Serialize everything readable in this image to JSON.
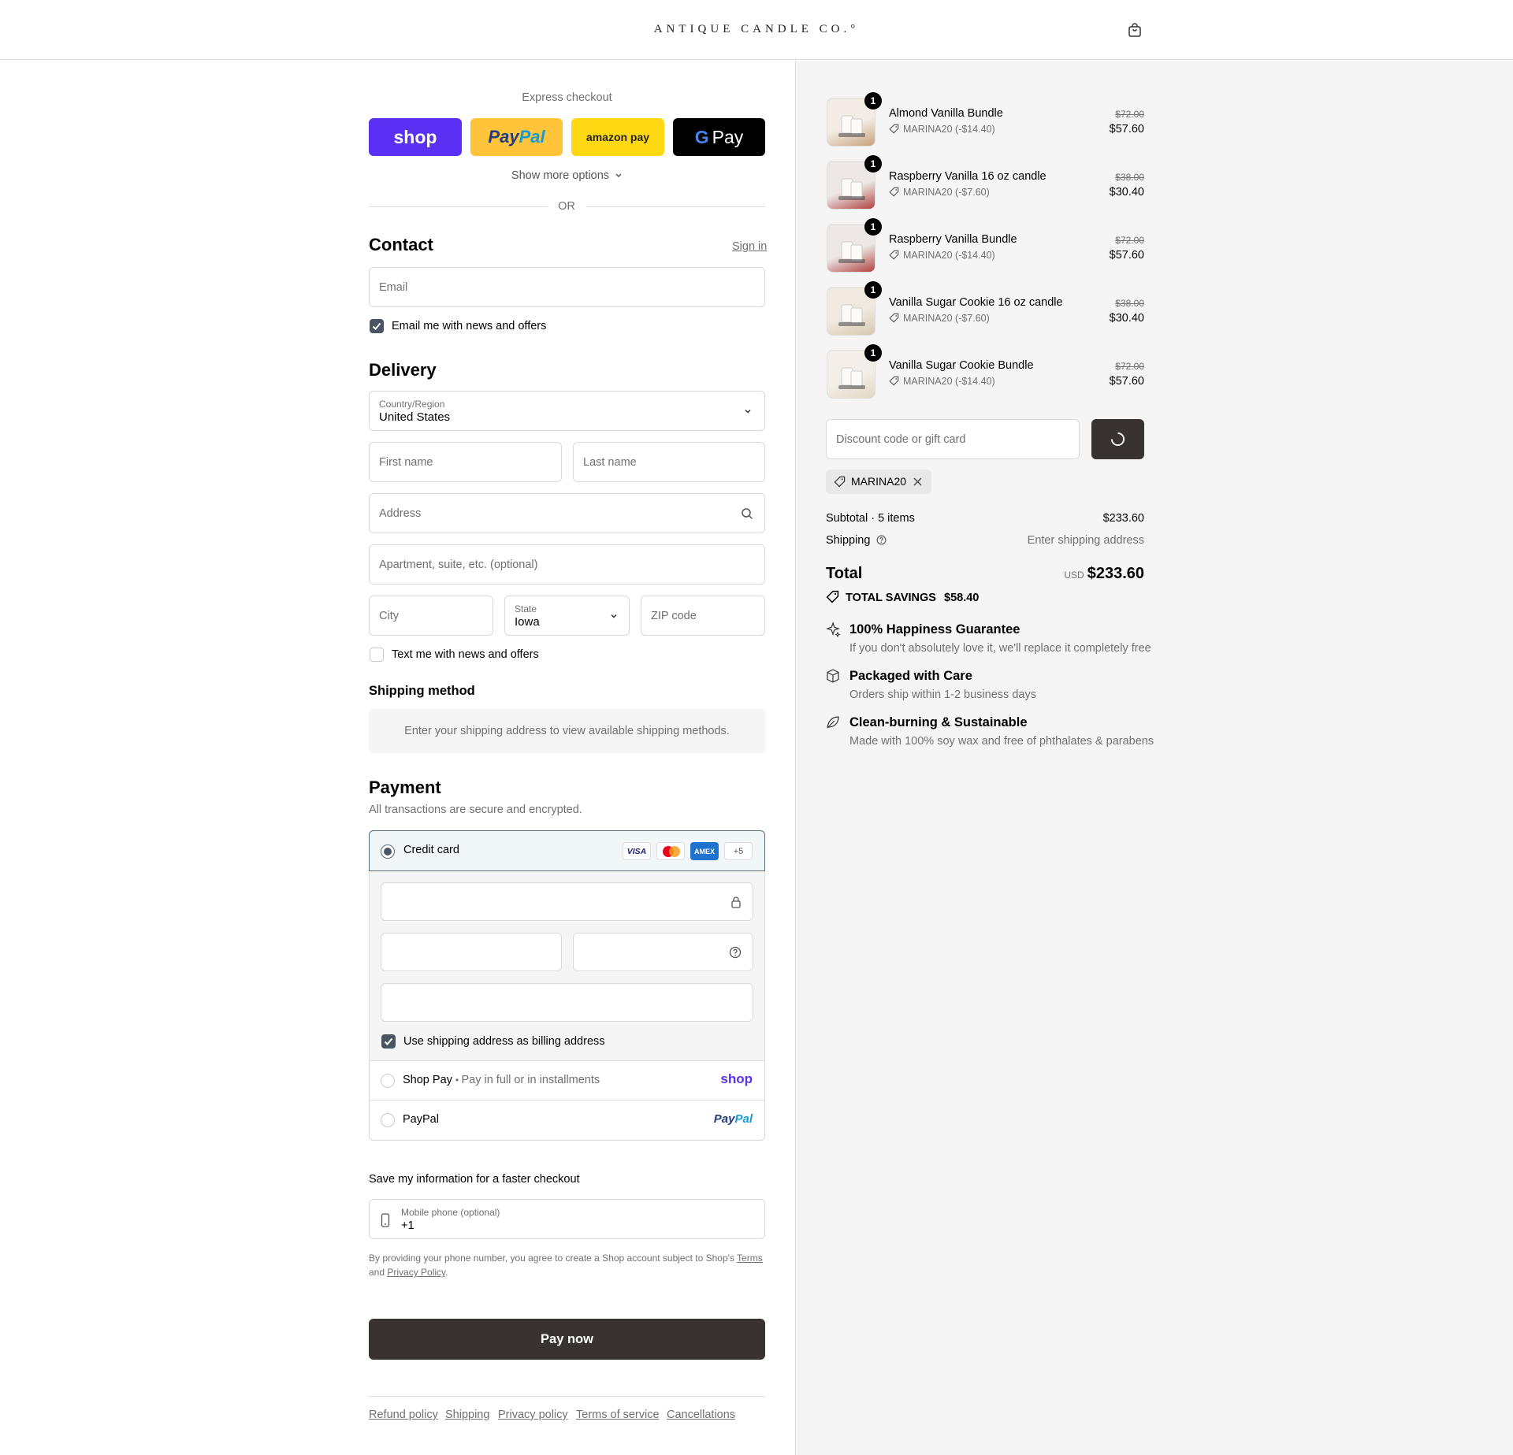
{
  "header": {
    "logo": "ANTIQUE CANDLE CO.°",
    "cart_icon": "cart-icon"
  },
  "express": {
    "title": "Express checkout",
    "buttons": {
      "shop": "shop",
      "paypal_a": "Pay",
      "paypal_b": "Pal",
      "amazon": "amazon pay",
      "gpay": "Pay"
    },
    "more": "Show more options",
    "or": "OR"
  },
  "contact": {
    "title": "Contact",
    "sign_in": "Sign in",
    "email_placeholder": "Email",
    "news_label": "Email me with news and offers"
  },
  "delivery": {
    "title": "Delivery",
    "country_label": "Country/Region",
    "country_value": "United States",
    "first_name": "First name",
    "last_name": "Last name",
    "address": "Address",
    "apartment": "Apartment, suite, etc. (optional)",
    "city": "City",
    "state_label": "State",
    "state_value": "Iowa",
    "zip": "ZIP code",
    "text_label": "Text me with news and offers"
  },
  "shipping_method": {
    "title": "Shipping method",
    "notice": "Enter your shipping address to view available shipping methods."
  },
  "payment": {
    "title": "Payment",
    "subtitle": "All transactions are secure and encrypted.",
    "credit_card": "Credit card",
    "brands": {
      "visa": "VISA",
      "amex": "AMEX",
      "more": "+5"
    },
    "billing_label": "Use shipping address as billing address",
    "shop_pay": "Shop Pay",
    "shop_pay_sub": "Pay in full or in installments",
    "shop_pay_logo": "shop",
    "paypal": "PayPal",
    "paypal_logo_a": "Pay",
    "paypal_logo_b": "Pal"
  },
  "save": {
    "title": "Save my information for a faster checkout",
    "phone_label": "Mobile phone (optional)",
    "phone_value": "+1",
    "consent_a": "By providing your phone number, you agree to create a Shop account subject to Shop's",
    "terms": "Terms",
    "consent_b": "and",
    "privacy": "Privacy Policy",
    "consent_c": "."
  },
  "pay_now": "Pay now",
  "footer": [
    "Refund policy",
    "Shipping",
    "Privacy policy",
    "Terms of service",
    "Cancellations"
  ],
  "items": [
    {
      "qty": "1",
      "name": "Almond Vanilla Bundle",
      "discount": "MARINA20 (-$14.40)",
      "old": "$72.00",
      "price": "$57.60"
    },
    {
      "qty": "1",
      "name": "Raspberry Vanilla 16 oz candle",
      "discount": "MARINA20 (-$7.60)",
      "old": "$38.00",
      "price": "$30.40"
    },
    {
      "qty": "1",
      "name": "Raspberry Vanilla Bundle",
      "discount": "MARINA20 (-$14.40)",
      "old": "$72.00",
      "price": "$57.60"
    },
    {
      "qty": "1",
      "name": "Vanilla Sugar Cookie 16 oz candle",
      "discount": "MARINA20 (-$7.60)",
      "old": "$38.00",
      "price": "$30.40"
    },
    {
      "qty": "1",
      "name": "Vanilla Sugar Cookie Bundle",
      "discount": "MARINA20 (-$14.40)",
      "old": "$72.00",
      "price": "$57.60"
    }
  ],
  "summary": {
    "discount_placeholder": "Discount code or gift card",
    "code_tag": "MARINA20",
    "subtotal_label": "Subtotal · 5 items",
    "subtotal_value": "$233.60",
    "shipping_label": "Shipping",
    "shipping_value": "Enter shipping address",
    "total_label": "Total",
    "currency": "USD",
    "total_value": "$233.60",
    "savings_label": "TOTAL SAVINGS",
    "savings_value": "$58.40"
  },
  "perks": [
    {
      "icon": "sparkle-icon",
      "title": "100% Happiness Guarantee",
      "text": "If you don't absolutely love it, we'll replace it completely free"
    },
    {
      "icon": "box-icon",
      "title": "Packaged with Care",
      "text": "Orders ship within 1-2 business days"
    },
    {
      "icon": "leaf-icon",
      "title": "Clean-burning & Sustainable",
      "text": "Made with 100% soy wax and free of phthalates & parabens"
    }
  ],
  "colors": {
    "shop": "#5a31f4",
    "paypal": "#ffc439",
    "amazon": "#ffd814",
    "dark_button": "#383330",
    "accent": "#4a5561"
  }
}
